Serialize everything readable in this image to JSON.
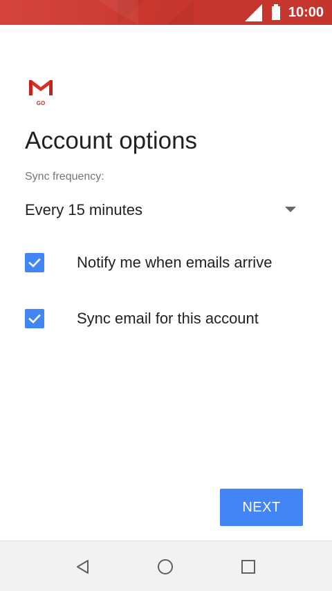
{
  "status_bar": {
    "time": "10:00",
    "signal_icon": "signal-icon",
    "battery_icon": "battery-icon"
  },
  "app": {
    "logo_icon": "gmail-go-logo",
    "logo_text": "GO"
  },
  "page": {
    "title": "Account options"
  },
  "sync": {
    "label": "Sync frequency:",
    "selected_value": "Every 15 minutes",
    "dropdown_icon": "arrow-drop-down-icon"
  },
  "options": [
    {
      "label": "Notify me when emails arrive",
      "checked": true
    },
    {
      "label": "Sync email for this account",
      "checked": true
    }
  ],
  "actions": {
    "next_label": "NEXT"
  },
  "nav_bar": {
    "back_icon": "back-icon",
    "home_icon": "home-icon",
    "recents_icon": "recents-icon"
  },
  "colors": {
    "status_bar": "#cb3a33",
    "accent": "#4285f4",
    "logo_red": "#d93025",
    "title_text": "#212121",
    "secondary_text": "#757575",
    "nav_bar_bg": "#f2f2f2"
  }
}
